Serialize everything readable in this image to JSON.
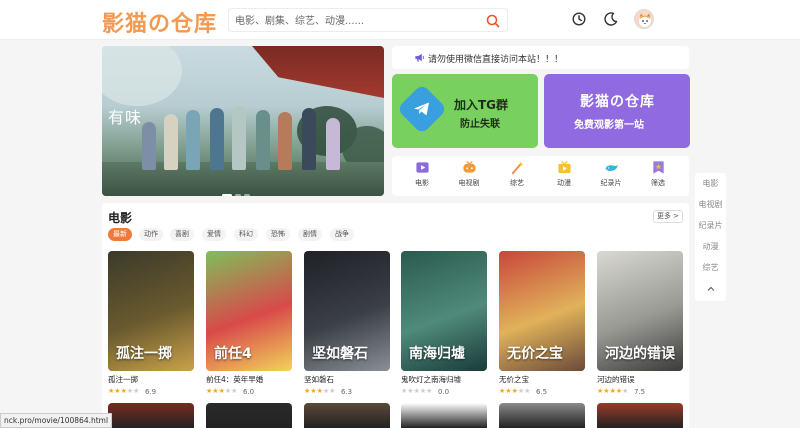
{
  "header": {
    "logo_text": "影猫の仓库",
    "search_placeholder": "电影、剧集、综艺、动漫......",
    "icons": [
      "history-icon",
      "dark-mode-icon",
      "avatar"
    ]
  },
  "banner": {
    "caption": "有味"
  },
  "notice": {
    "icon": "megaphone-icon",
    "text": "请勿使用微信直接访问本站！！！"
  },
  "promo": {
    "tg": {
      "line1": "加入TG群",
      "line2": "防止失联",
      "icon": "telegram-icon"
    },
    "site": {
      "line1": "影猫の仓库",
      "line2": "免费观影第一站"
    }
  },
  "categories": [
    {
      "label": "电影",
      "icon": "movie-icon",
      "color": "#8b6bd9"
    },
    {
      "label": "电视剧",
      "icon": "tv-icon",
      "color": "#f29b38"
    },
    {
      "label": "综艺",
      "icon": "magic-wand-icon",
      "color": "#f28a4a"
    },
    {
      "label": "动漫",
      "icon": "anime-icon",
      "color": "#f2c230"
    },
    {
      "label": "纪录片",
      "icon": "whale-icon",
      "color": "#2fb8d8"
    },
    {
      "label": "筛选",
      "icon": "filter-star-icon",
      "color": "#9a78e6"
    }
  ],
  "sidenav": {
    "items": [
      "电影",
      "电视剧",
      "纪录片",
      "动漫",
      "综艺"
    ],
    "up_icon": "chevron-up-icon"
  },
  "section": {
    "title": "电影",
    "more_label": "更多 >",
    "tabs": [
      "最新",
      "动作",
      "喜剧",
      "爱情",
      "科幻",
      "恐怖",
      "剧情",
      "战争"
    ],
    "active_tab": "最新",
    "movies": [
      {
        "title": "孤注一掷",
        "poster_text": "孤注一掷",
        "stars_filled": 3,
        "score": "6.9",
        "colors": [
          "#3b3a2a",
          "#6a5a2e",
          "#c9a24a"
        ]
      },
      {
        "title": "前任4：英年早婚",
        "poster_text": "前任4",
        "stars_filled": 3,
        "score": "6.0",
        "colors": [
          "#7fbf5a",
          "#d84a4a",
          "#f2d35a"
        ]
      },
      {
        "title": "坚如磐石",
        "poster_text": "坚如磐石",
        "stars_filled": 3,
        "score": "6.3",
        "colors": [
          "#1e2126",
          "#3b3f46",
          "#8a8f96"
        ]
      },
      {
        "title": "鬼吹灯之南海归墟",
        "poster_text": "南海归墟",
        "stars_filled": 0,
        "score": "0.0",
        "colors": [
          "#2a5a4e",
          "#4f8a7a",
          "#1a3a3a"
        ]
      },
      {
        "title": "无价之宝",
        "poster_text": "无价之宝",
        "stars_filled": 3,
        "score": "6.5",
        "colors": [
          "#c8473a",
          "#e0b25a",
          "#6b4a3a"
        ]
      },
      {
        "title": "河边的错误",
        "poster_text": "河边的错误",
        "stars_filled": 4,
        "score": "7.5",
        "colors": [
          "#d9d9d2",
          "#9a9a95",
          "#3a3a38"
        ]
      }
    ],
    "next_row_colors": [
      "#7a2a20",
      "#2a2a2a",
      "#5a4a3a",
      "#ffffff",
      "#8a8a8a",
      "#9a3a2a"
    ]
  },
  "status_url": "nck.pro/movie/100864.html"
}
